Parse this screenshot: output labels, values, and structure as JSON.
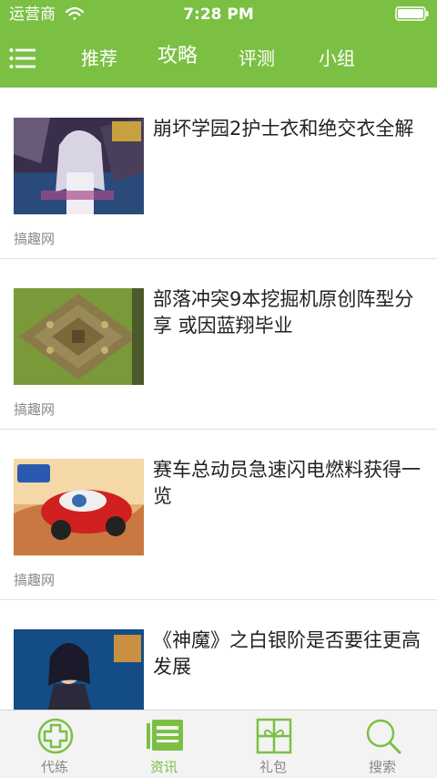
{
  "status_bar": {
    "carrier": "运营商",
    "time": "7:28 PM"
  },
  "nav": {
    "tabs": [
      {
        "label": "推荐",
        "active": false
      },
      {
        "label": "攻略",
        "active": true
      },
      {
        "label": "评测",
        "active": false
      },
      {
        "label": "小组",
        "active": false
      }
    ]
  },
  "articles": [
    {
      "title": "崩坏学园2护士衣和绝交衣全解",
      "source": "搞趣网",
      "thumbnail": "anime-character-image"
    },
    {
      "title": "部落冲突9本挖掘机原创阵型分享 或因蓝翔毕业",
      "source": "搞趣网",
      "thumbnail": "clash-base-image"
    },
    {
      "title": "赛车总动员急速闪电燃料获得一览",
      "source": "搞趣网",
      "thumbnail": "cars-game-image"
    },
    {
      "title": "《神魔》之白银阶是否要往更高发展",
      "source": "",
      "thumbnail": "game-heroine-image"
    }
  ],
  "tabbar": {
    "items": [
      {
        "label": "代练",
        "icon": "cross-circle-icon",
        "selected": false
      },
      {
        "label": "资讯",
        "icon": "news-icon",
        "selected": true
      },
      {
        "label": "礼包",
        "icon": "gift-icon",
        "selected": false
      },
      {
        "label": "搜索",
        "icon": "search-icon",
        "selected": false
      }
    ]
  },
  "colors": {
    "brand": "#7bc043",
    "text": "#222222",
    "muted": "#888888"
  }
}
